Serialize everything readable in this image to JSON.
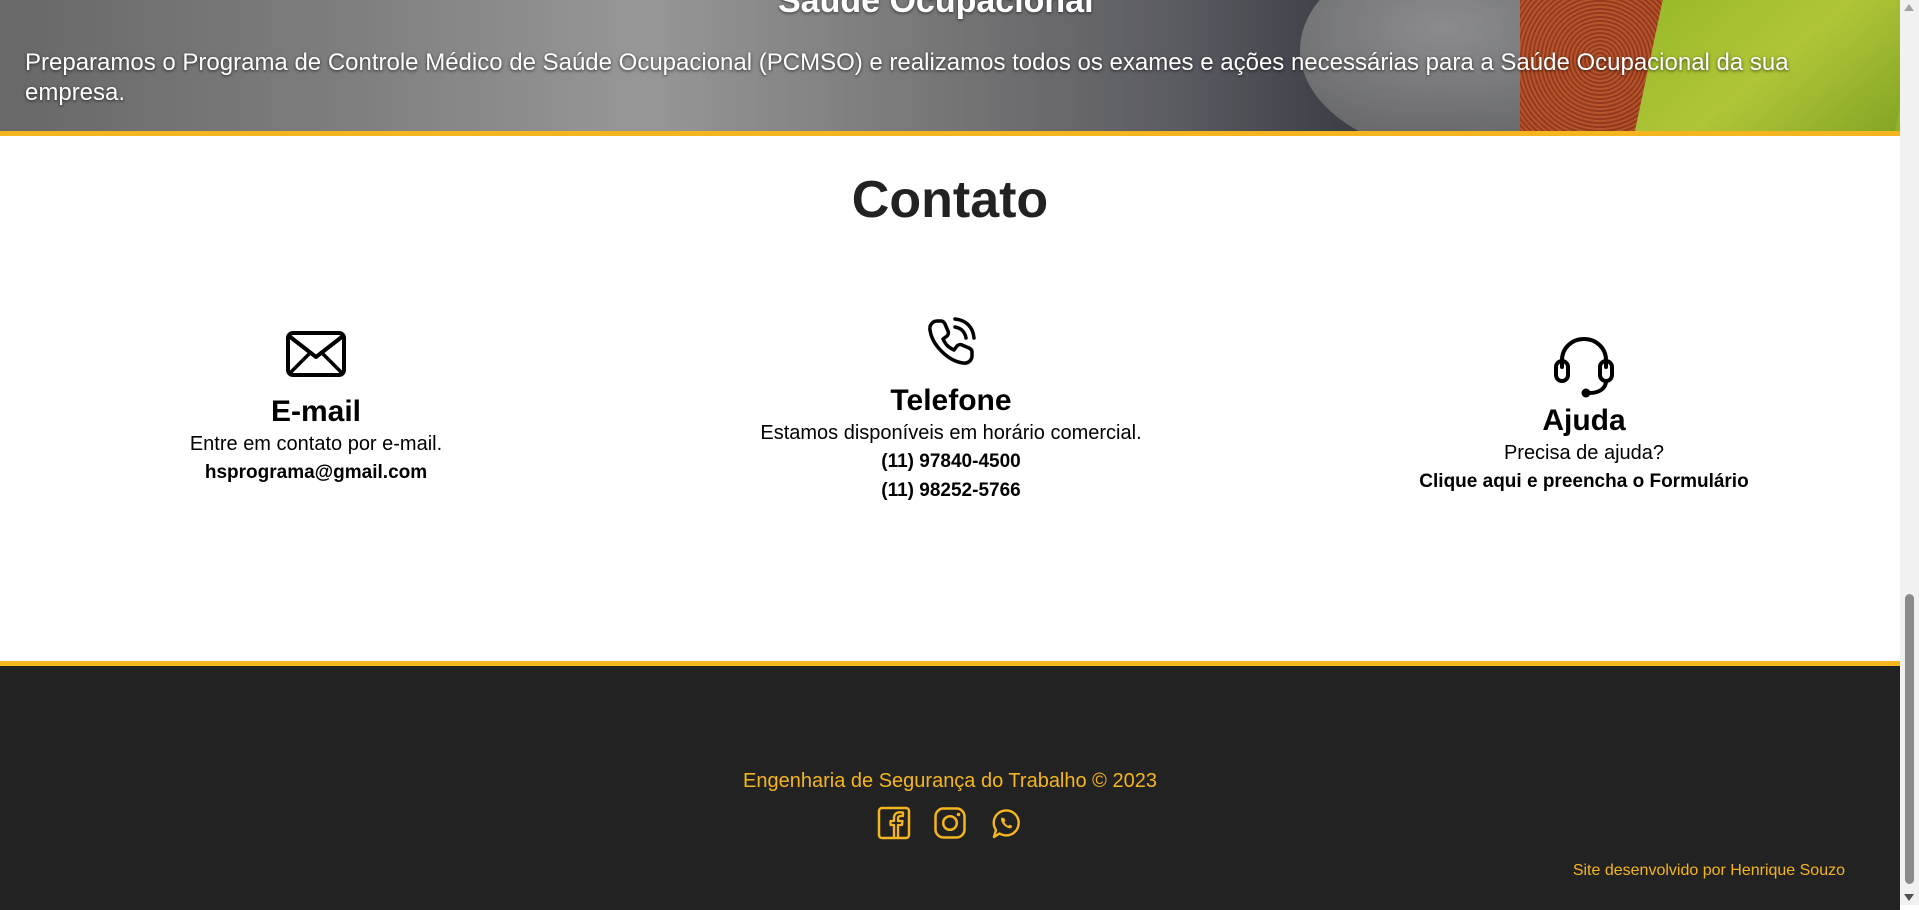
{
  "hero": {
    "title": "Saúde Ocupacional",
    "text": "Preparamos o Programa de Controle Médico de Saúde Ocupacional (PCMSO) e realizamos todos os exames e ações necessárias para a Saúde Ocupacional da sua empresa."
  },
  "contact": {
    "title": "Contato",
    "email": {
      "icon": "envelope-icon",
      "heading": "E-mail",
      "description": "Entre em contato por e-mail.",
      "address": "hsprograma@gmail.com"
    },
    "phone": {
      "icon": "phone-icon",
      "heading": "Telefone",
      "description": "Estamos disponíveis em horário comercial.",
      "numbers": [
        "(11) 97840-4500",
        "(11) 98252-5766"
      ]
    },
    "help": {
      "icon": "headset-icon",
      "heading": "Ajuda",
      "description": "Precisa de ajuda?",
      "link": "Clique aqui e preencha o Formulário"
    }
  },
  "footer": {
    "copyright": "Engenharia de Segurança do Trabalho © 2023",
    "social": [
      {
        "icon": "facebook-icon"
      },
      {
        "icon": "instagram-icon"
      },
      {
        "icon": "whatsapp-icon"
      }
    ],
    "developer": "Site desenvolvido por Henrique Souzo"
  },
  "colors": {
    "accent": "#f5b51f",
    "footer_bg": "#222222",
    "heading": "#222222"
  }
}
